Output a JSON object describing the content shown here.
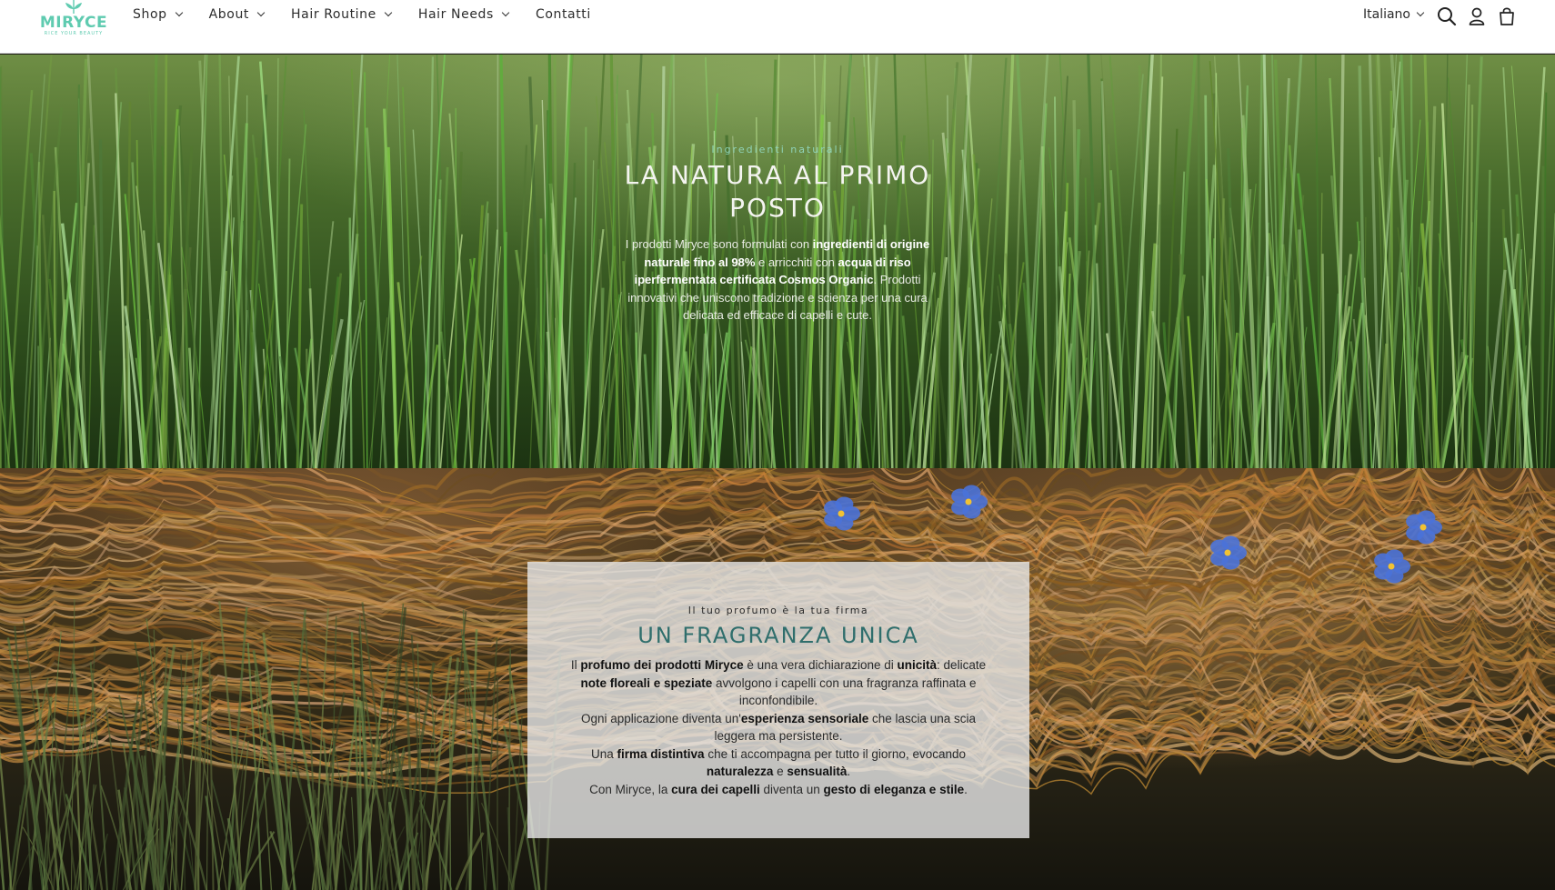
{
  "header": {
    "logo": {
      "name": "MIRYCE",
      "tagline": "RICE YOUR BEAUTY"
    },
    "nav": [
      {
        "label": "Shop",
        "dropdown": true
      },
      {
        "label": "About",
        "dropdown": true
      },
      {
        "label": "Hair Routine",
        "dropdown": true
      },
      {
        "label": "Hair Needs",
        "dropdown": true
      },
      {
        "label": "Contatti",
        "dropdown": false
      }
    ],
    "language": "Italiano",
    "icons": [
      "search-icon",
      "account-icon",
      "cart-icon"
    ]
  },
  "hero": {
    "eyebrow": "Ingredienti naturali",
    "title": "LA NATURA AL PRIMO POSTO",
    "body": [
      {
        "t": "I prodotti Miryce sono formulati con ",
        "b": false
      },
      {
        "t": "ingredienti di origine naturale fino al 98%",
        "b": true
      },
      {
        "t": " e arricchiti con ",
        "b": false
      },
      {
        "t": "acqua di riso iperfermentata certificata Cosmos Organic",
        "b": true
      },
      {
        "t": ". Prodotti innovativi che uniscono tradizione e scienza per una cura delicata ed efficace di capelli e cute.",
        "b": false
      }
    ]
  },
  "fragrance": {
    "eyebrow": "Il tuo profumo è la tua firma",
    "title": "UN FRAGRANZA UNICA",
    "paragraphs": [
      [
        {
          "t": "Il ",
          "b": false
        },
        {
          "t": "profumo dei prodotti Miryce",
          "b": true
        },
        {
          "t": " è una vera dichiarazione di ",
          "b": false
        },
        {
          "t": "unicità",
          "b": true
        },
        {
          "t": ": delicate ",
          "b": false
        },
        {
          "t": "note floreali e speziate",
          "b": true
        },
        {
          "t": " avvolgono i capelli con una fragranza raffinata e inconfondibile.",
          "b": false
        }
      ],
      [
        {
          "t": "Ogni applicazione diventa un'",
          "b": false
        },
        {
          "t": "esperienza sensoriale",
          "b": true
        },
        {
          "t": " che lascia una scia leggera ma persistente.",
          "b": false
        }
      ],
      [
        {
          "t": "Una ",
          "b": false
        },
        {
          "t": "firma distintiva",
          "b": true
        },
        {
          "t": " che ti accompagna per tutto il giorno, evocando ",
          "b": false
        },
        {
          "t": "naturalezza",
          "b": true
        },
        {
          "t": " e ",
          "b": false
        },
        {
          "t": "sensualità",
          "b": true
        },
        {
          "t": ".",
          "b": false
        }
      ],
      [
        {
          "t": "Con Miryce, la ",
          "b": false
        },
        {
          "t": "cura dei capelli",
          "b": true
        },
        {
          "t": " diventa un ",
          "b": false
        },
        {
          "t": "gesto di eleganza e stile",
          "b": true
        },
        {
          "t": ".",
          "b": false
        }
      ]
    ]
  },
  "colors": {
    "brand": "#5fcbb0",
    "card_title": "#2f6e6c",
    "hero_eyebrow": "#8fd3b8"
  }
}
